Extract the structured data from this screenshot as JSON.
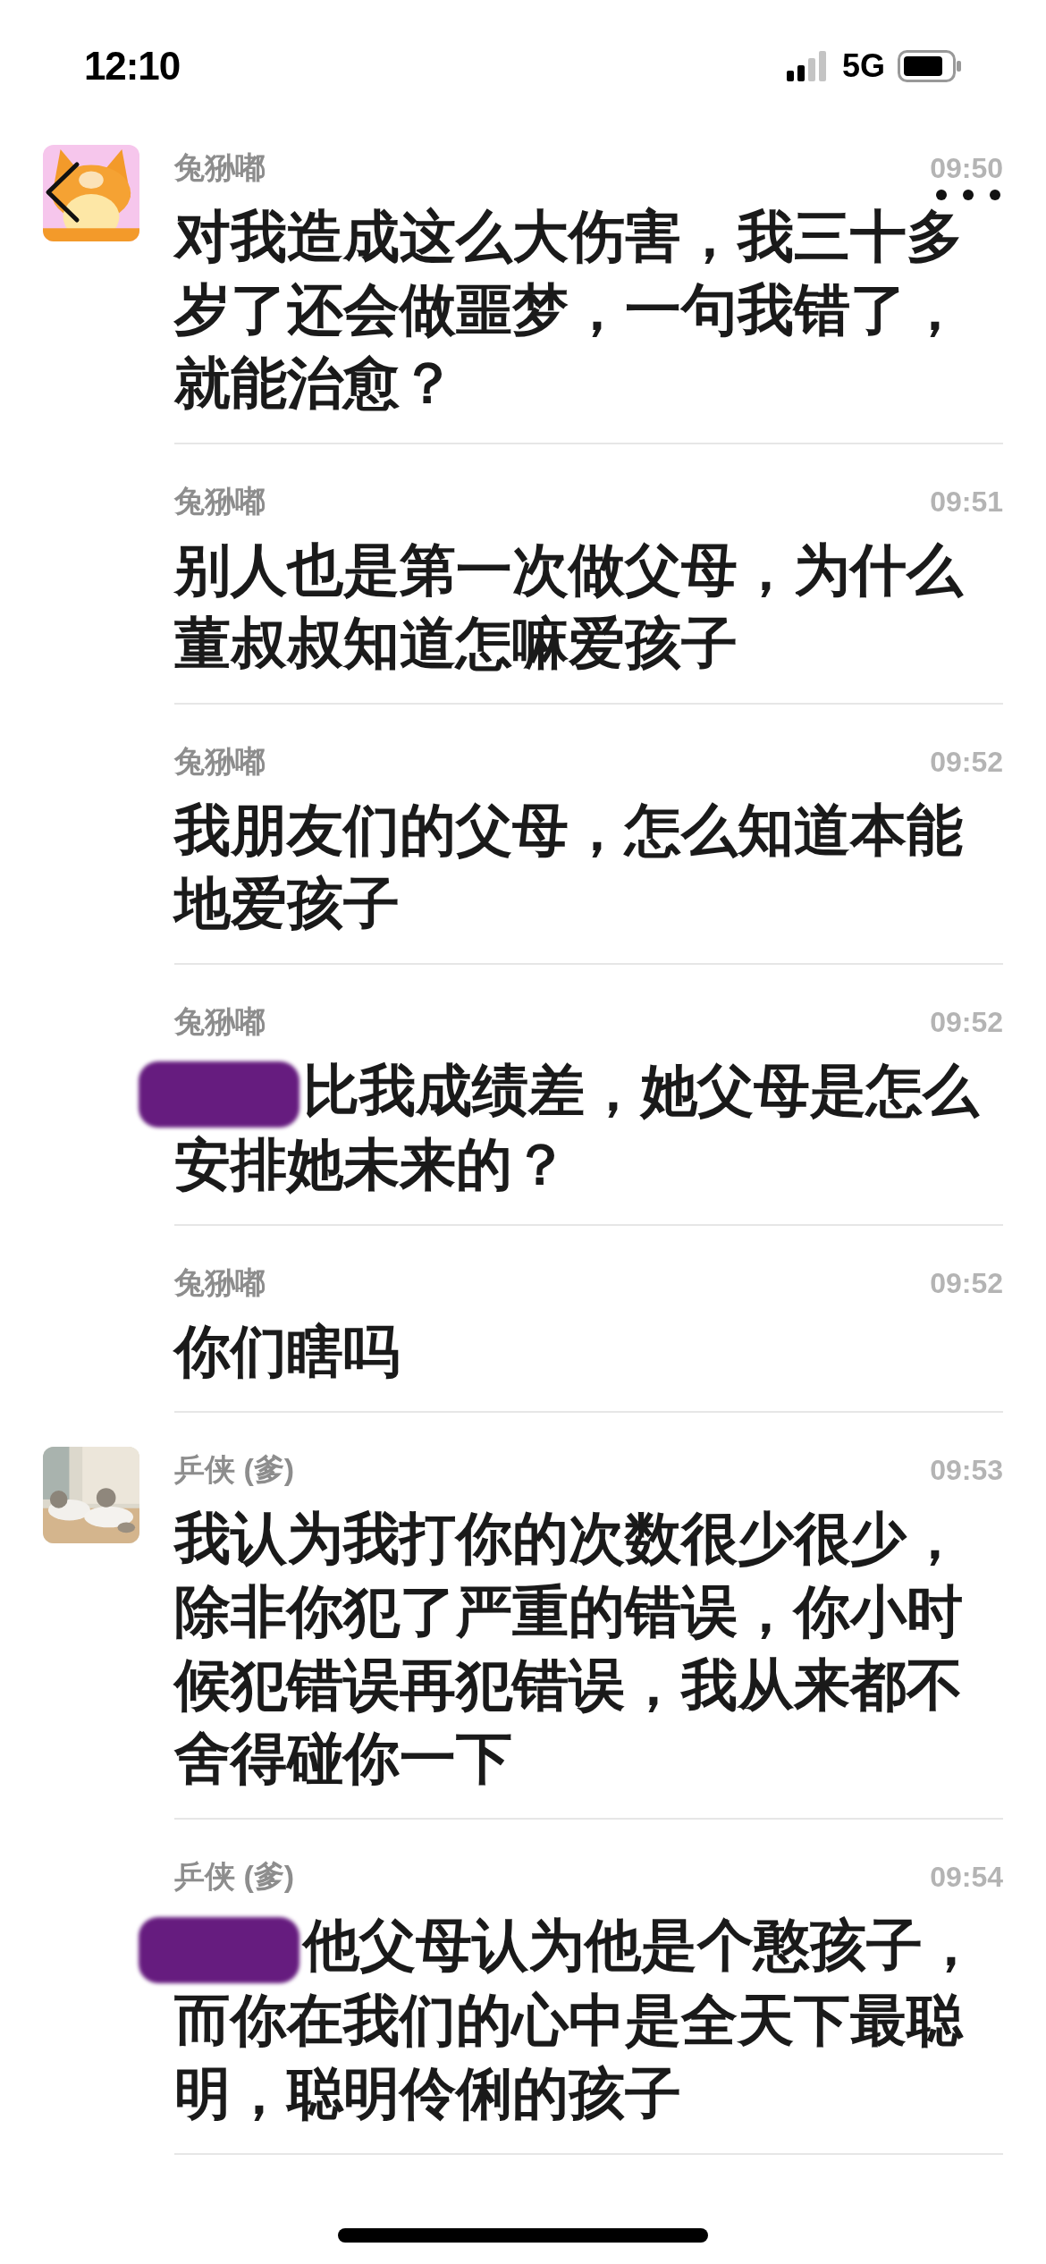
{
  "status_bar": {
    "time": "12:10",
    "network": "5G"
  },
  "messages": [
    {
      "sender": "兔狲嘟",
      "time": "09:50",
      "avatar": true,
      "redacted": false,
      "text": "对我造成这么大伤害，我三十多岁了还会做噩梦，一句我错了，就能治愈？"
    },
    {
      "sender": "兔狲嘟",
      "time": "09:51",
      "avatar": false,
      "redacted": false,
      "text": "别人也是第一次做父母，为什么董叔叔知道怎嘛爱孩子"
    },
    {
      "sender": "兔狲嘟",
      "time": "09:52",
      "avatar": false,
      "redacted": false,
      "text": "我朋友们的父母，怎么知道本能地爱孩子"
    },
    {
      "sender": "兔狲嘟",
      "time": "09:52",
      "avatar": false,
      "redacted": true,
      "text": "比我成绩差，她父母是怎么安排她未来的？"
    },
    {
      "sender": "兔狲嘟",
      "time": "09:52",
      "avatar": false,
      "redacted": false,
      "text": "你们瞎吗"
    },
    {
      "sender": "乒侠 (爹)",
      "time": "09:53",
      "avatar": true,
      "redacted": false,
      "text": "我认为我打你的次数很少很少，除非你犯了严重的错误，你小时候犯错误再犯错误，我从来都不舍得碰你一下"
    },
    {
      "sender": "乒侠 (爹)",
      "time": "09:54",
      "avatar": false,
      "redacted": true,
      "text": "他父母认为他是个憨孩子，而你在我们的心中是全天下最聪明，聪明伶俐的孩子"
    }
  ]
}
